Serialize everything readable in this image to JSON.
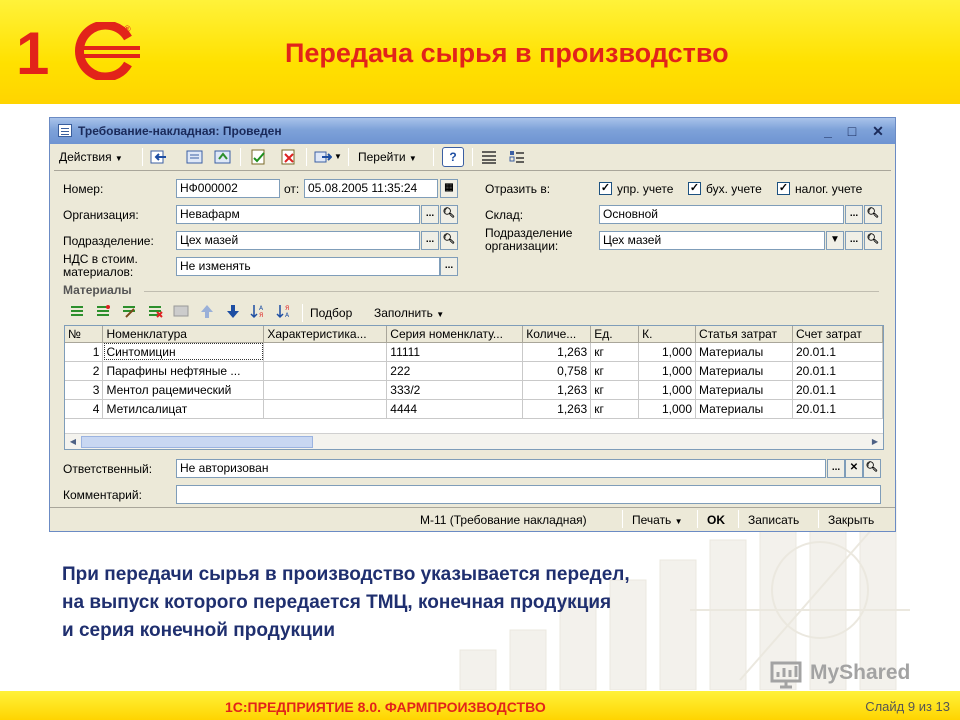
{
  "slide": {
    "title": "Передача сырья в производство",
    "description_lines": [
      "При передачи сырья в производство указывается передел,",
      "на выпуск которого передается ТМЦ, конечная продукция",
      "и серия конечной продукции"
    ],
    "footer_title": "1С:ПРЕДПРИЯТИЕ 8.0. ФАРМПРОИЗВОДСТВО",
    "slide_counter": "Слайд 9 из 13",
    "watermark": "MyShared",
    "logo_text": "1С"
  },
  "colors": {
    "accent_red": "#e2231a",
    "header_yellow": "#ffe100",
    "window_bg": "#ece9d8",
    "titlebar_blue": "#7ea2d9",
    "text_navy": "#1f2f6f"
  },
  "window": {
    "title": "Требование-накладная: Проведен",
    "controls": {
      "minimize": "_",
      "maximize": "□",
      "close": "✕"
    }
  },
  "toolbar": {
    "actions_label": "Действия",
    "goto_label": "Перейти",
    "help_label": "?"
  },
  "form": {
    "number_label": "Номер:",
    "number_value": "НФ000002",
    "date_from_label": "от:",
    "date_value": "05.08.2005 11:35:24",
    "org_label": "Организация:",
    "org_value": "Невафарм",
    "dept_label": "Подразделение:",
    "dept_value": "Цех мазей",
    "vat_label_line1": "НДС в стоим.",
    "vat_label_line2": "материалов:",
    "vat_value": "Не изменять",
    "reflect_label": "Отразить в:",
    "reflect_options": [
      {
        "label": "упр. учете",
        "checked": true
      },
      {
        "label": "бух. учете",
        "checked": true
      },
      {
        "label": "налог. учете",
        "checked": true
      }
    ],
    "warehouse_label": "Склад:",
    "warehouse_value": "Основной",
    "org_dept_label_line1": "Подразделение",
    "org_dept_label_line2": "организации:",
    "org_dept_value": "Цех мазей",
    "responsible_label": "Ответственный:",
    "responsible_value": "Не авторизован",
    "comment_label": "Комментарий:",
    "comment_value": ""
  },
  "materials": {
    "section_label": "Материалы",
    "toolbar": {
      "selection_label": "Подбор",
      "fill_label": "Заполнить"
    },
    "columns": [
      "№",
      "Номенклатура",
      "Характеристика...",
      "Серия номенклату...",
      "Количе...",
      "Ед.",
      "К.",
      "Статья затрат",
      "Счет затрат"
    ],
    "rows": [
      [
        "1",
        "Синтомицин",
        "",
        "11111",
        "1,263",
        "кг",
        "1,000",
        "Материалы",
        "20.01.1"
      ],
      [
        "2",
        "Парафины нефтяные ...",
        "",
        "222",
        "0,758",
        "кг",
        "1,000",
        "Материалы",
        "20.01.1"
      ],
      [
        "3",
        "Ментол рацемический",
        "",
        "333/2",
        "1,263",
        "кг",
        "1,000",
        "Материалы",
        "20.01.1"
      ],
      [
        "4",
        "Метилсалицат",
        "",
        "4444",
        "1,263",
        "кг",
        "1,000",
        "Материалы",
        "20.01.1"
      ]
    ]
  },
  "status": {
    "form_name": "М-11 (Требование накладная)",
    "print_label": "Печать",
    "ok_label": "OK",
    "save_label": "Записать",
    "close_label": "Закрыть"
  }
}
